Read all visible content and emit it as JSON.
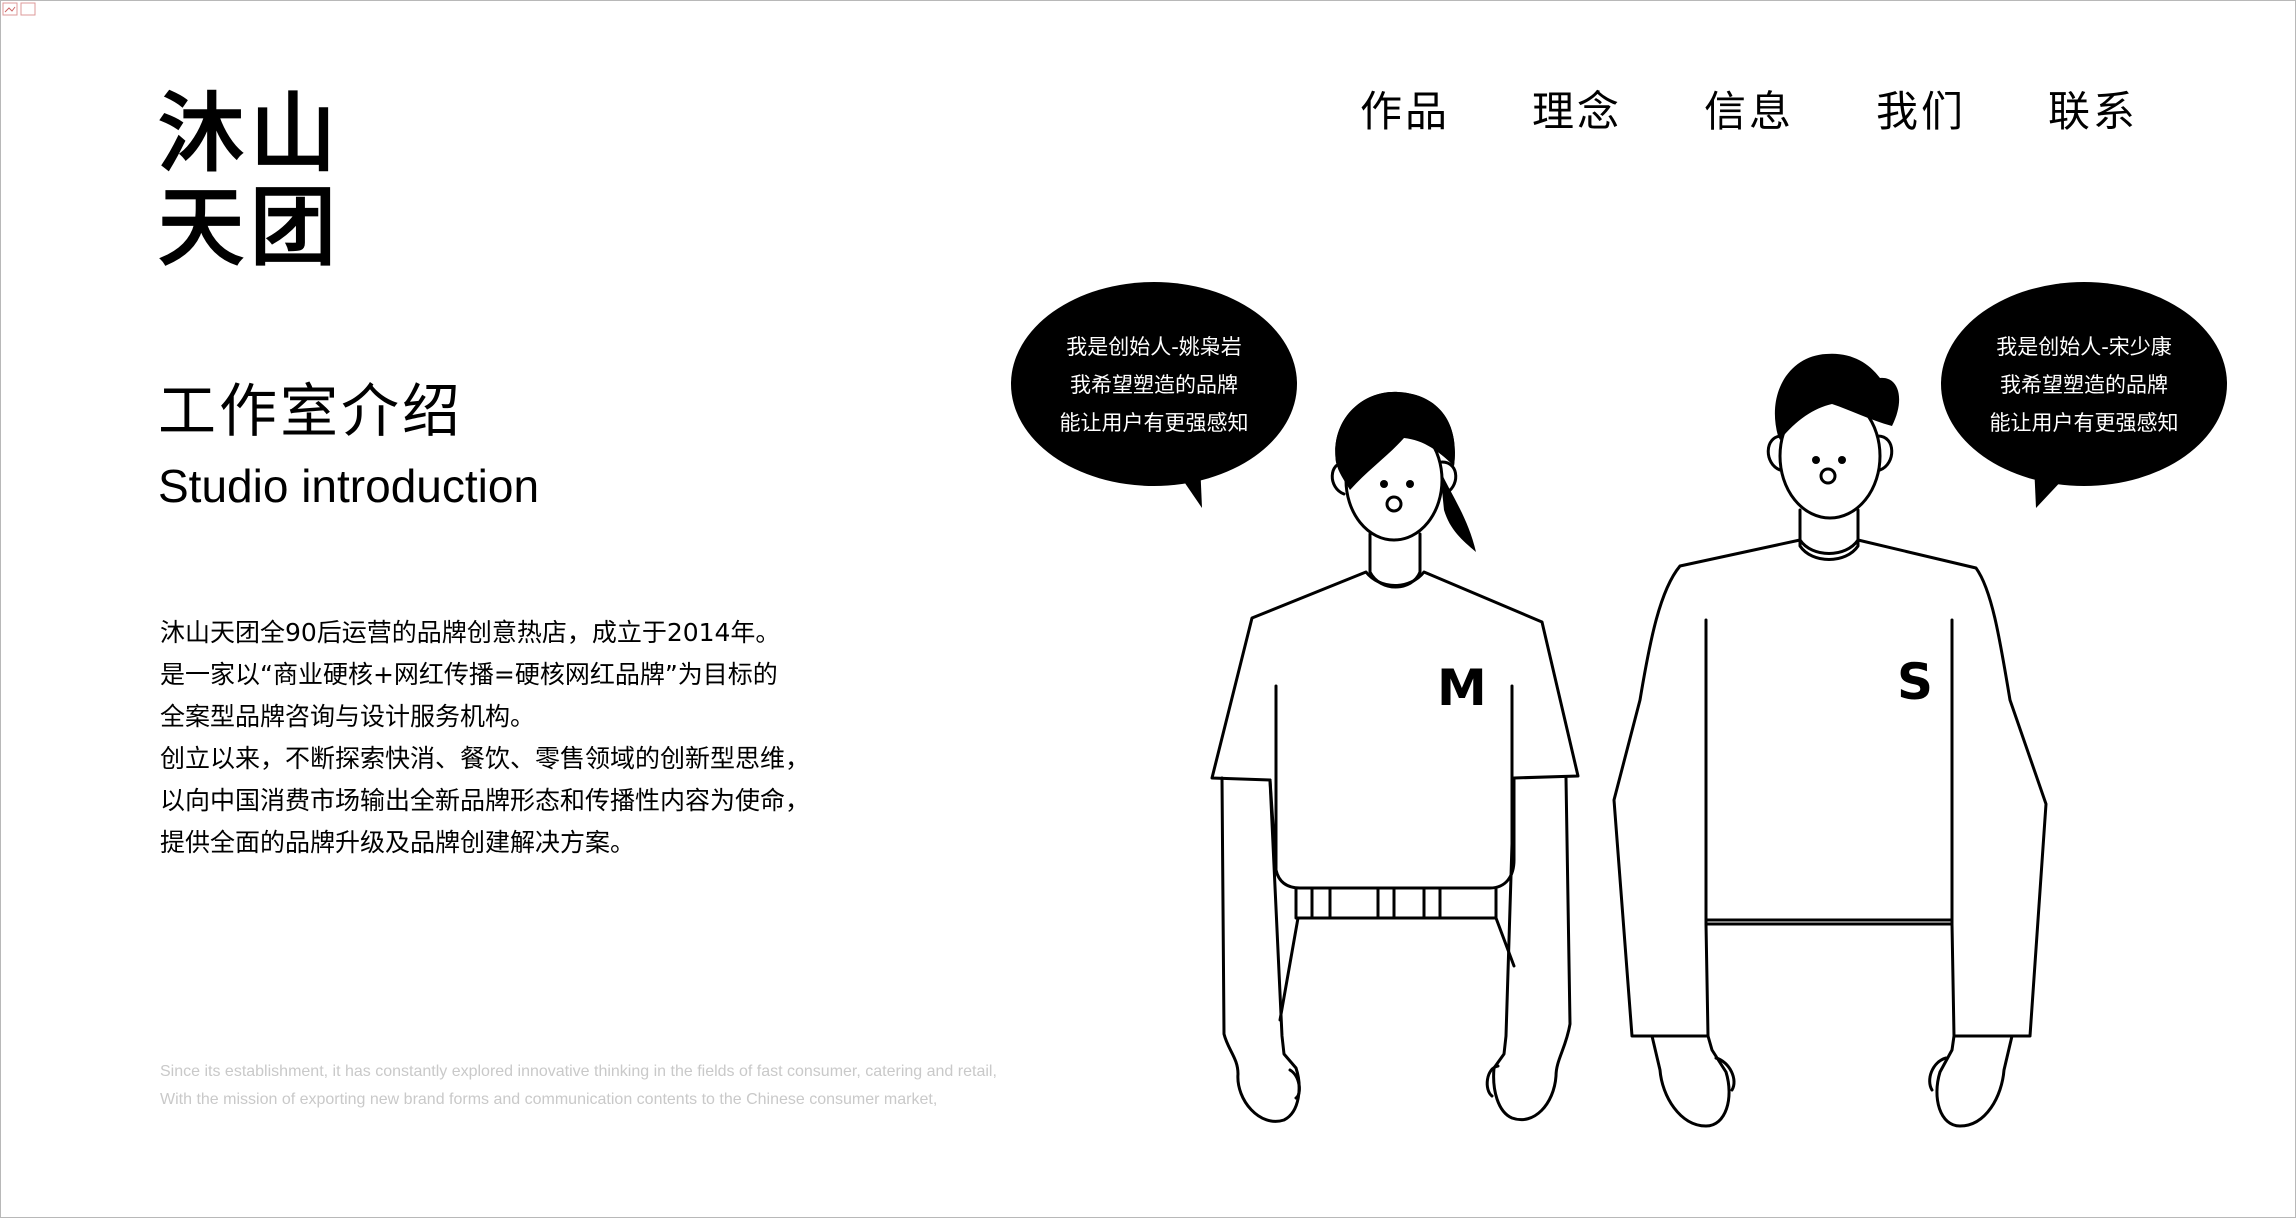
{
  "logo": {
    "line1": "沐山",
    "line2": "天团"
  },
  "nav": {
    "items": [
      {
        "label": "作品"
      },
      {
        "label": "理念"
      },
      {
        "label": "信息"
      },
      {
        "label": "我们"
      },
      {
        "label": "联系"
      }
    ]
  },
  "section": {
    "title_zh": "工作室介绍",
    "title_en": "Studio introduction"
  },
  "intro": {
    "lines": [
      "沐山天团全90后运营的品牌创意热店，成立于2014年。",
      "是一家以“商业硬核+网红传播=硬核网红品牌”为目标的",
      "全案型品牌咨询与设计服务机构。",
      "创立以来，不断探索快消、餐饮、零售领域的创新型思维，",
      "以向中国消费市场输出全新品牌形态和传播性内容为使命，",
      "提供全面的品牌升级及品牌创建解决方案。"
    ]
  },
  "english_note": {
    "lines": [
      "Since its establishment, it has constantly explored innovative thinking in the fields of fast consumer, catering and retail,",
      "With the mission of exporting new brand forms and communication contents to the Chinese consumer market,"
    ]
  },
  "founders": [
    {
      "bubble": [
        "我是创始人-姚枭岩",
        "我希望塑造的品牌",
        "能让用户有更强感知"
      ],
      "shirt_letter": "M"
    },
    {
      "bubble": [
        "我是创始人-宋少康",
        "我希望塑造的品牌",
        "能让用户有更强感知"
      ],
      "shirt_letter": "S"
    }
  ],
  "colors": {
    "background": "#ffffff",
    "ink": "#000000",
    "faint_text": "#c9c9c9"
  }
}
